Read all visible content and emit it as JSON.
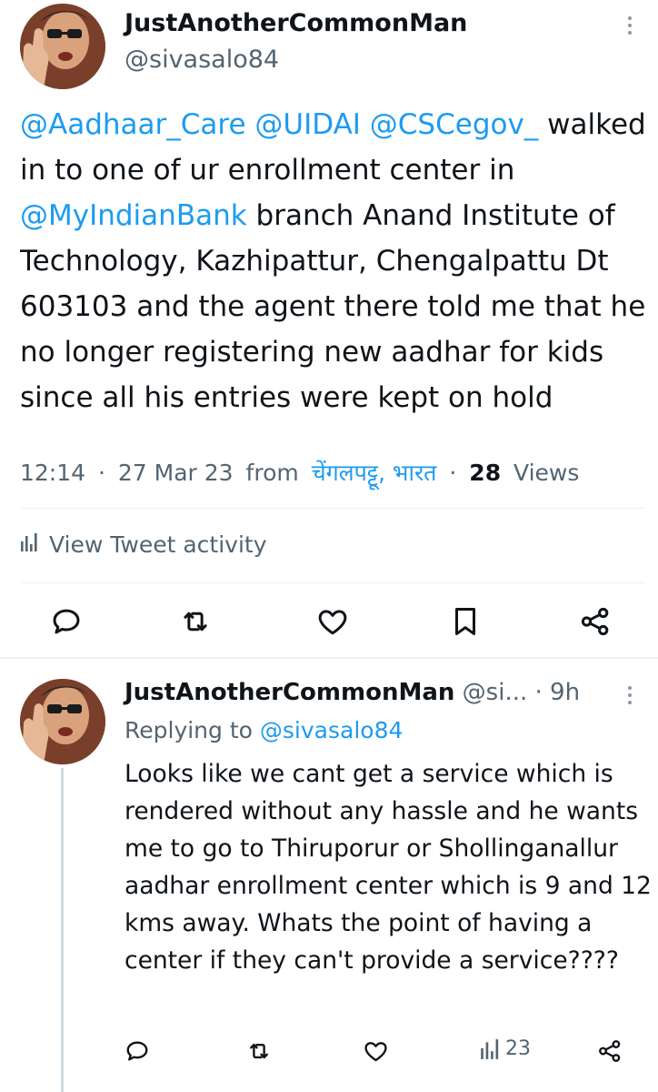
{
  "main": {
    "author_name": "JustAnotherCommonMan",
    "author_handle": "@sivasalo84",
    "text_parts": [
      {
        "t": "@Aadhaar_Care",
        "mention": true
      },
      {
        "t": " ",
        "mention": false
      },
      {
        "t": "@UIDAI",
        "mention": true
      },
      {
        "t": " ",
        "mention": false
      },
      {
        "t": "@CSCegov_",
        "mention": true
      },
      {
        "t": " walked in to one of ur enrollment center in ",
        "mention": false
      },
      {
        "t": "@MyIndianBank",
        "mention": true
      },
      {
        "t": " branch Anand Institute of Technology, Kazhipattur, Chengalpattu Dt 603103 and the agent there told me that he no longer registering new aadhar for kids since all his entries were kept on hold",
        "mention": false
      }
    ],
    "time": "12:14",
    "date": "27 Mar 23",
    "from_label": "from",
    "location": "चेंगलपट्टू, भारत",
    "views_count": "28",
    "views_label": "Views",
    "separator": "·",
    "activity_label": "View Tweet activity"
  },
  "reply": {
    "author_name": "JustAnotherCommonMan",
    "author_handle": "@si...",
    "age": "· 9h",
    "replying_label": "Replying to",
    "replying_to": "@sivasalo84",
    "text": "Looks like we cant get a service which is rendered without any hassle and he wants me to go to Thiruporur or Shollinganallur aadhar enrollment center which is 9 and 12 kms away. Whats the point of having a center if they can't provide a service????",
    "views_count": "23"
  },
  "icons": {
    "reply": "reply-icon",
    "retweet": "retweet-icon",
    "like": "heart-icon",
    "bookmark": "bookmark-icon",
    "share": "share-icon",
    "analytics": "analytics-icon",
    "more": "more-vertical-icon"
  },
  "colors": {
    "accent": "#1d9bf0",
    "text": "#0f1419",
    "secondary": "#536471",
    "divider": "#eff3f4"
  }
}
